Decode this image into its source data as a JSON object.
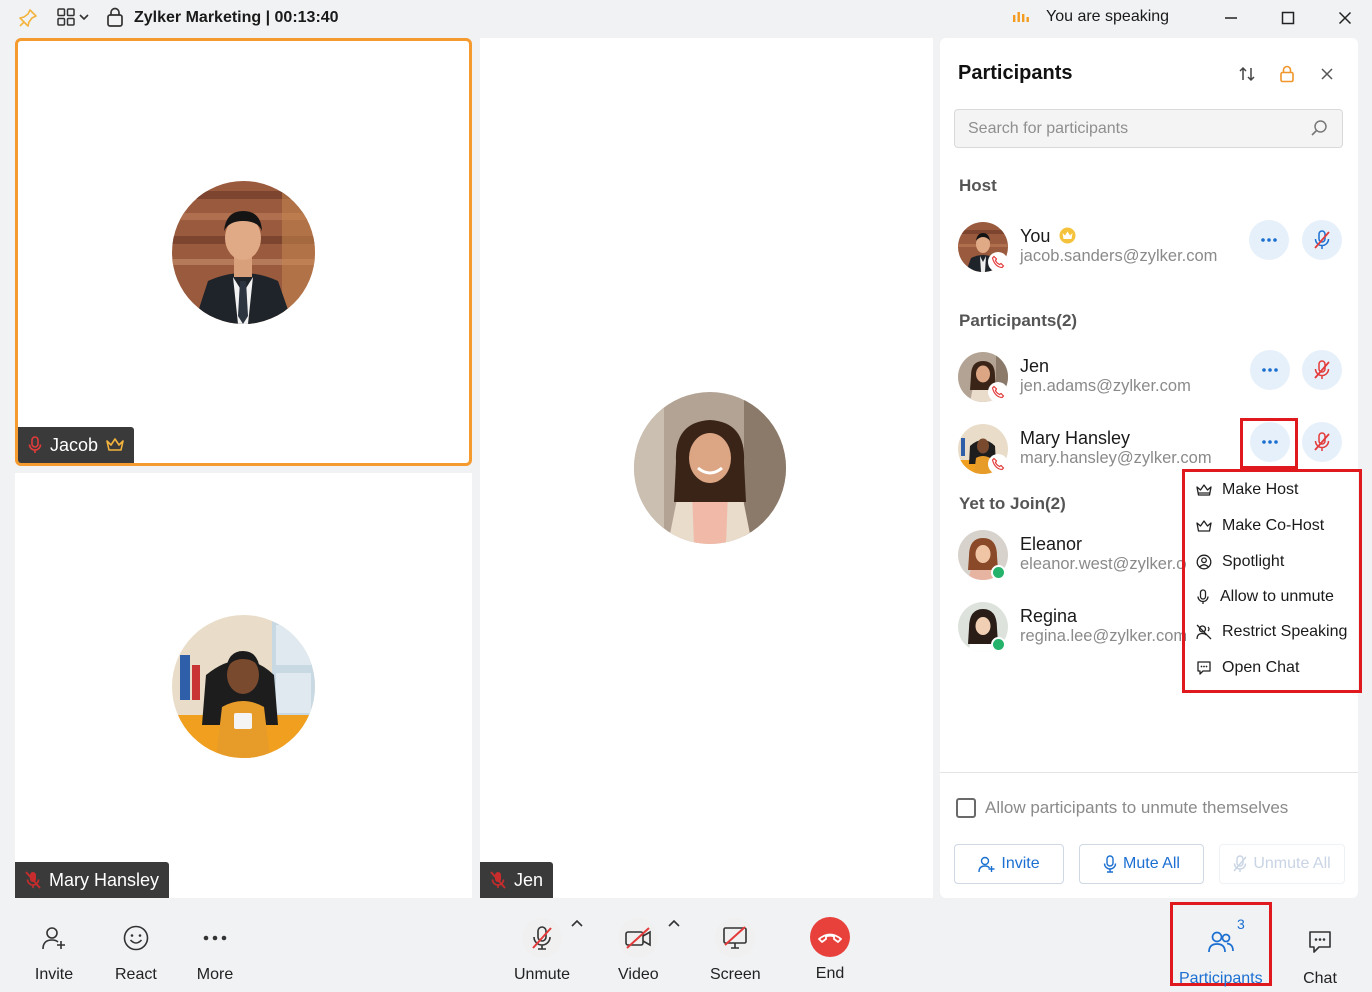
{
  "titlebar": {
    "meeting_title": "Zylker Marketing |",
    "timer": "00:13:40",
    "speaking_status": "You are speaking"
  },
  "tiles": [
    {
      "name": "Jacob",
      "mic": "on",
      "is_host": true
    },
    {
      "name": "Mary Hansley",
      "mic": "off"
    },
    {
      "name": "Jen",
      "mic": "off"
    }
  ],
  "panel": {
    "title": "Participants",
    "search_placeholder": "Search for participants",
    "host_label": "Host",
    "host": {
      "name": "You",
      "email": "jacob.sanders@zylker.com"
    },
    "participants_label": "Participants(2)",
    "participants": [
      {
        "name": "Jen",
        "email": "jen.adams@zylker.com"
      },
      {
        "name": "Mary Hansley",
        "email": "mary.hansley@zylker.com"
      }
    ],
    "yet_to_join_label": "Yet to Join(2)",
    "yet_to_join": [
      {
        "name": "Eleanor",
        "email": "eleanor.west@zylker.com"
      },
      {
        "name": "Regina",
        "email": "regina.lee@zylker.com"
      }
    ],
    "allow_unmute_label": "Allow participants to unmute themselves",
    "buttons": {
      "invite": "Invite",
      "mute_all": "Mute All",
      "unmute_all": "Unmute All"
    }
  },
  "context_menu": {
    "items": [
      "Make Host",
      "Make Co-Host",
      "Spotlight",
      "Allow to unmute",
      "Restrict Speaking",
      "Open Chat"
    ]
  },
  "toolbar": {
    "invite": "Invite",
    "react": "React",
    "more": "More",
    "unmute": "Unmute",
    "video": "Video",
    "screen": "Screen",
    "end": "End",
    "participants": "Participants",
    "participants_count": "3",
    "chat": "Chat"
  },
  "colors": {
    "accent": "#1b6fd1",
    "active_border": "#f59a2f",
    "end_red": "#e8403b",
    "highlight": "#e0191f",
    "online": "#25b26b"
  }
}
